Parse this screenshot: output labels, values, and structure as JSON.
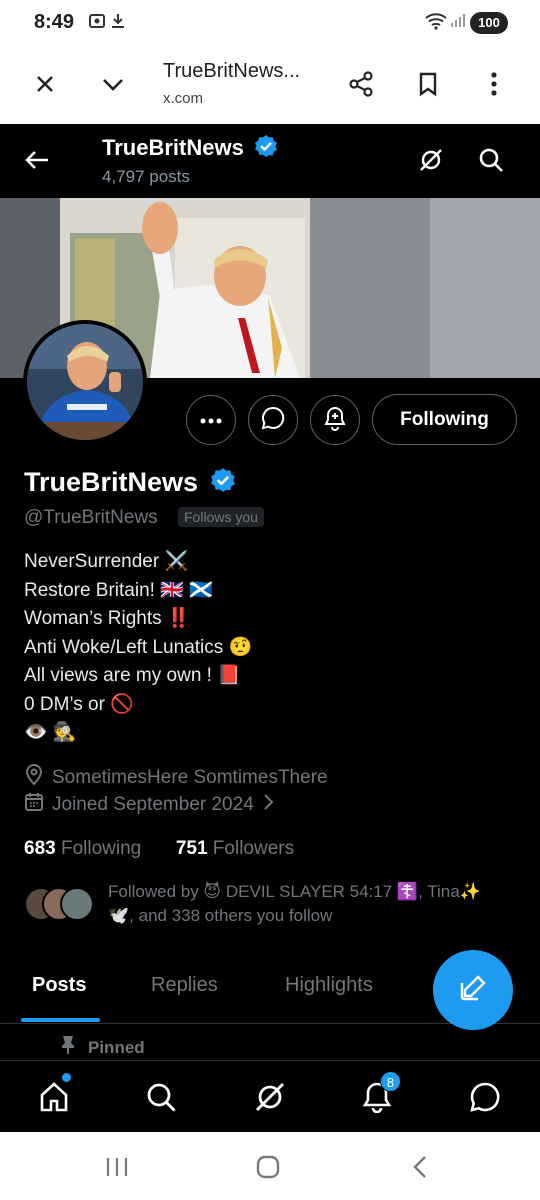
{
  "status_bar": {
    "time": "8:49",
    "battery": "100"
  },
  "browser": {
    "title": "TrueBritNews...",
    "domain": "x.com"
  },
  "header": {
    "name": "TrueBritNews",
    "posts": "4,797 posts"
  },
  "profile": {
    "name": "TrueBritNews",
    "handle": "@TrueBritNews",
    "follows_you": "Follows you",
    "following_button": "Following",
    "bio_lines": [
      "NeverSurrender ⚔️",
      "Restore Britain! 🇬🇧 🏴󠁧󠁢󠁳󠁣󠁴󠁿",
      "Woman’s Rights ‼️",
      "Anti Woke/Left Lunatics 🤨",
      "All views are my own ! 📕",
      "0 DM’s or 🚫",
      "👁️ 🕵️"
    ],
    "location": "SometimesHere SomtimesThere",
    "joined": "Joined September 2024",
    "following_count": "683",
    "following_label": "Following",
    "followers_count": "751",
    "followers_label": "Followers",
    "followed_by_line1": "Followed by 😈 DEVIL SLAYER 54:17 ☦️, Tina✨",
    "followed_by_line2": "🕊️, and 338 others you follow"
  },
  "tabs": [
    "Posts",
    "Replies",
    "Highlights"
  ],
  "pinned_label": "Pinned",
  "notifications_badge": "8",
  "colors": {
    "accent": "#1d9bf0",
    "background": "#000000"
  },
  "icons": [
    "close-icon",
    "chevron-down-icon",
    "share-icon",
    "bookmark-icon",
    "more-vert-icon",
    "back-arrow-icon",
    "verified-badge-icon",
    "grok-icon",
    "search-icon",
    "more-horizontal-icon",
    "message-icon",
    "add-notification-icon",
    "location-icon",
    "calendar-icon",
    "chevron-right-icon",
    "compose-icon",
    "pin-icon",
    "home-icon",
    "bell-icon"
  ]
}
